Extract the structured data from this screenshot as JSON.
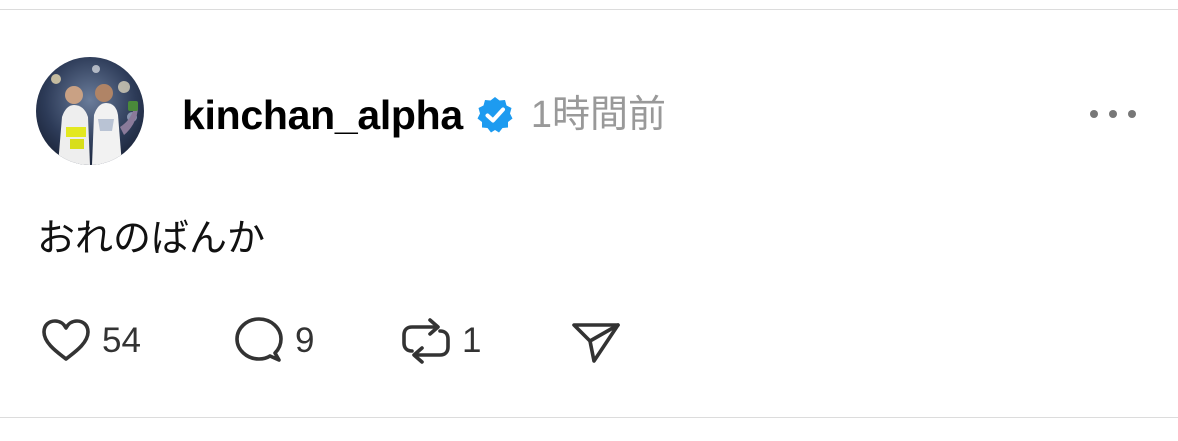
{
  "post": {
    "username": "kinchan_alpha",
    "verified_icon": "verified-badge-icon",
    "timestamp": "1時間前",
    "text": "おれのばんか",
    "more_icon": "more-options-icon"
  },
  "actions": {
    "like": {
      "icon": "heart-icon",
      "count": "54"
    },
    "reply": {
      "icon": "comment-bubble-icon",
      "count": "9"
    },
    "repost": {
      "icon": "repost-icon",
      "count": "1"
    },
    "share": {
      "icon": "send-icon"
    }
  },
  "colors": {
    "verified": "#1d9bf0",
    "timestamp": "#999999",
    "icon_stroke": "#333333",
    "divider": "#dcdcdc"
  }
}
